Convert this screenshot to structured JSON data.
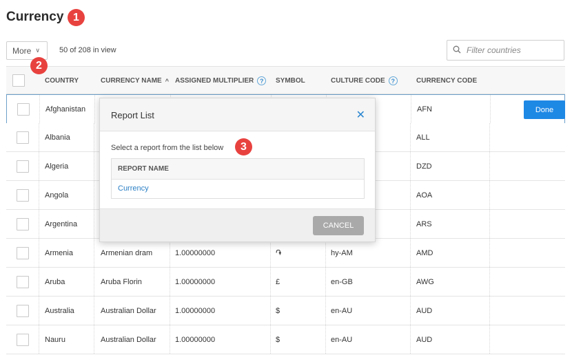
{
  "page": {
    "title": "Currency"
  },
  "annotations": [
    "1",
    "2",
    "3"
  ],
  "toolbar": {
    "more_label": "More",
    "count_text": "50 of 208 in view"
  },
  "search": {
    "placeholder": "Filter countries"
  },
  "table": {
    "headers": [
      "COUNTRY",
      "CURRENCY NAME",
      "ASSIGNED MULTIPLIER",
      "SYMBOL",
      "CULTURE CODE",
      "CURRENCY CODE"
    ],
    "sort_column": "CURRENCY NAME",
    "sort_direction": "ascending",
    "done_label": "Done",
    "rows": [
      {
        "country": "Afghanistan",
        "currency_name": "",
        "multiplier": "",
        "symbol": "",
        "culture_code": "",
        "currency_code": "AFN"
      },
      {
        "country": "Albania",
        "currency_name": "",
        "multiplier": "",
        "symbol": "",
        "culture_code": "",
        "currency_code": "ALL"
      },
      {
        "country": "Algeria",
        "currency_name": "",
        "multiplier": "",
        "symbol": "",
        "culture_code": "",
        "currency_code": "DZD"
      },
      {
        "country": "Angola",
        "currency_name": "",
        "multiplier": "",
        "symbol": "",
        "culture_code": "",
        "currency_code": "AOA"
      },
      {
        "country": "Argentina",
        "currency_name": "",
        "multiplier": "",
        "symbol": "",
        "culture_code": "",
        "currency_code": "ARS"
      },
      {
        "country": "Armenia",
        "currency_name": "Armenian dram",
        "multiplier": "1.00000000",
        "symbol": "֏",
        "culture_code": "hy-AM",
        "currency_code": "AMD"
      },
      {
        "country": "Aruba",
        "currency_name": "Aruba Florin",
        "multiplier": "1.00000000",
        "symbol": "£",
        "culture_code": "en-GB",
        "currency_code": "AWG"
      },
      {
        "country": "Australia",
        "currency_name": "Australian Dollar",
        "multiplier": "1.00000000",
        "symbol": "$",
        "culture_code": "en-AU",
        "currency_code": "AUD"
      },
      {
        "country": "Nauru",
        "currency_name": "Australian Dollar",
        "multiplier": "1.00000000",
        "symbol": "$",
        "culture_code": "en-AU",
        "currency_code": "AUD"
      }
    ]
  },
  "modal": {
    "title": "Report List",
    "message": "Select a report from the list below",
    "column_header": "REPORT NAME",
    "reports": [
      "Currency"
    ],
    "cancel_label": "CANCEL"
  },
  "colors": {
    "accent": "#1e88e5",
    "badge": "#e8423f",
    "link": "#2a7fc5"
  }
}
